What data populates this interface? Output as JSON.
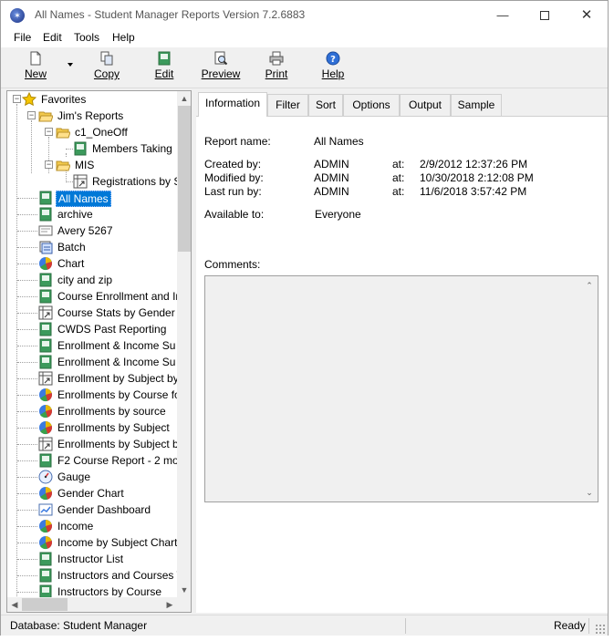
{
  "window": {
    "title": "All Names - Student Manager Reports Version 7.2.6883",
    "controls": {
      "minimize": "—",
      "close": "✕"
    }
  },
  "menu": [
    "File",
    "Edit",
    "Tools",
    "Help"
  ],
  "toolbar": {
    "new": "New",
    "copy": "Copy",
    "edit": "Edit",
    "preview": "Preview",
    "print": "Print",
    "help": "Help"
  },
  "tree": {
    "favorites": "Favorites",
    "jims_reports": "Jim's Reports",
    "c1_oneoff": "c1_OneOff",
    "members_taking": "Members Taking",
    "mis": "MIS",
    "registrations": "Registrations by S",
    "reports": [
      {
        "label": "All Names",
        "icon": "report-icon"
      },
      {
        "label": "archive",
        "icon": "report-icon"
      },
      {
        "label": "Avery 5267",
        "icon": "label-icon"
      },
      {
        "label": "Batch",
        "icon": "batch-icon"
      },
      {
        "label": "Chart",
        "icon": "pie-chart-icon"
      },
      {
        "label": "city and zip",
        "icon": "report-icon"
      },
      {
        "label": "Course Enrollment and In",
        "icon": "report-icon"
      },
      {
        "label": "Course Stats by Gender",
        "icon": "crosstab-icon"
      },
      {
        "label": "CWDS Past Reporting",
        "icon": "report-icon"
      },
      {
        "label": "Enrollment & Income Su",
        "icon": "report-icon"
      },
      {
        "label": "Enrollment & Income Su",
        "icon": "report-icon"
      },
      {
        "label": "Enrollment by Subject by",
        "icon": "crosstab-icon"
      },
      {
        "label": "Enrollments by Course fo",
        "icon": "pie-chart-icon"
      },
      {
        "label": "Enrollments by source",
        "icon": "pie-chart-icon"
      },
      {
        "label": "Enrollments by Subject",
        "icon": "pie-chart-icon"
      },
      {
        "label": "Enrollments by Subject b",
        "icon": "crosstab-icon"
      },
      {
        "label": "F2 Course Report - 2 mo",
        "icon": "report-icon"
      },
      {
        "label": "Gauge",
        "icon": "gauge-icon"
      },
      {
        "label": "Gender Chart",
        "icon": "pie-chart-icon"
      },
      {
        "label": "Gender Dashboard",
        "icon": "dashboard-icon"
      },
      {
        "label": "Income",
        "icon": "pie-chart-icon"
      },
      {
        "label": "Income by Subject Chart",
        "icon": "pie-chart-icon"
      },
      {
        "label": "Instructor List",
        "icon": "report-icon"
      },
      {
        "label": "Instructors and Courses T",
        "icon": "report-icon"
      },
      {
        "label": "Instructors by Course",
        "icon": "report-icon"
      }
    ]
  },
  "tabs": [
    "Information",
    "Filter",
    "Sort",
    "Options",
    "Output",
    "Sample"
  ],
  "info": {
    "report_name_label": "Report name:",
    "report_name": "All Names",
    "created_label": "Created by:",
    "created_by": "ADMIN",
    "created_at_label": "at:",
    "created_at": "2/9/2012 12:37:26 PM",
    "modified_label": "Modified by:",
    "modified_by": "ADMIN",
    "modified_at_label": "at:",
    "modified_at": "10/30/2018 2:12:08 PM",
    "lastrun_label": "Last run by:",
    "lastrun_by": "ADMIN",
    "lastrun_at_label": "at:",
    "lastrun_at": "11/6/2018 3:57:42 PM",
    "available_label": "Available to:",
    "available_to": "Everyone",
    "comments_label": "Comments:"
  },
  "status": {
    "database": "Database: Student Manager",
    "state": "Ready"
  }
}
